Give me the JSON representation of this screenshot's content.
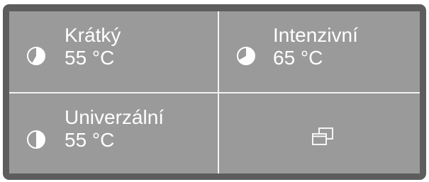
{
  "programs": [
    {
      "name": "Krátký",
      "temp": "55 °C",
      "icon": "pie-short-icon"
    },
    {
      "name": "Intenzivní",
      "temp": "65 °C",
      "icon": "pie-intensive-icon"
    },
    {
      "name": "Univerzální",
      "temp": "55 °C",
      "icon": "pie-universal-icon"
    }
  ],
  "more": {
    "icon": "windows-stack-icon"
  },
  "colors": {
    "frame": "#5d5d5d",
    "screen": "#9a9a9a",
    "text": "#ffffff"
  }
}
